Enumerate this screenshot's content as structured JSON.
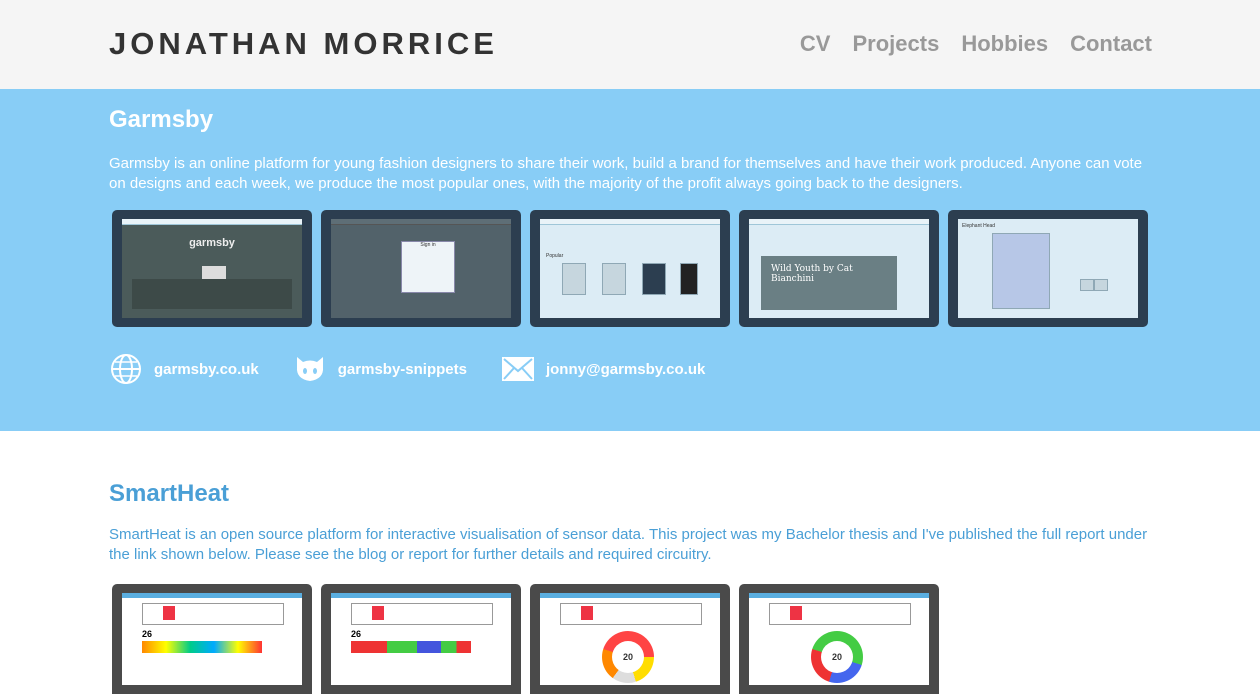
{
  "header": {
    "logo": "JONATHAN MORRICE",
    "nav": [
      "CV",
      "Projects",
      "Hobbies",
      "Contact"
    ]
  },
  "garmsby": {
    "title": "Garmsby",
    "description": "Garmsby is an online platform for young fashion designers to share their work, build a brand for themselves and have their work produced. Anyone can vote on designs and each week, we produce the most popular ones, with the majority of the profit always going back to the designers.",
    "screenshots": [
      {
        "mock": "garmsby",
        "caption": "garmsby"
      },
      {
        "mock": "sign in",
        "caption": "Sign in"
      },
      {
        "mock": "designs",
        "caption": "Popular"
      },
      {
        "mock": "news",
        "caption": "Wild Youth by Cat Bianchini"
      },
      {
        "mock": "design detail",
        "caption": "Elephant Head"
      }
    ],
    "links": [
      {
        "icon": "globe-icon",
        "label": "garmsby.co.uk"
      },
      {
        "icon": "github-icon",
        "label": "garmsby-snippets"
      },
      {
        "icon": "mail-icon",
        "label": "jonny@garmsby.co.uk"
      }
    ]
  },
  "smartheat": {
    "title": "SmartHeat",
    "description": "SmartHeat is an open source platform for interactive visualisation of sensor data. This project was my Bachelor thesis and I've published the full report under the link shown below. Please see the blog or report for further details and required circuitry.",
    "screenshots": [
      {
        "mock": "heatmap",
        "value": "26"
      },
      {
        "mock": "timeline",
        "value": "26"
      },
      {
        "mock": "donut",
        "value": "20"
      },
      {
        "mock": "donut",
        "value": "20"
      }
    ]
  },
  "colors": {
    "header_bg": "#f5f5f5",
    "garmsby_bg": "#88cdf6",
    "smartheat_title": "#4a9fd6",
    "nav_text": "#999999"
  }
}
